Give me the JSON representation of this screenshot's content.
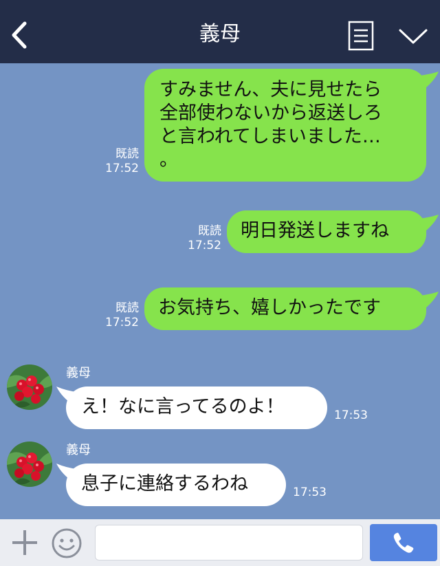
{
  "header": {
    "title": "義母",
    "back_icon": "chevron-left-icon",
    "notes_icon": "notes-icon",
    "menu_icon": "chevron-down-icon"
  },
  "messages": [
    {
      "direction": "outgoing",
      "lines": [
        "すみません、夫に見せたら",
        "全部使わないから返送しろ",
        "と言われてしまいました…",
        "。"
      ],
      "read": "既読",
      "time": "17:52"
    },
    {
      "direction": "outgoing",
      "lines": [
        "明日発送しますね"
      ],
      "read": "既読",
      "time": "17:52"
    },
    {
      "direction": "outgoing",
      "lines": [
        "お気持ち、嬉しかったです"
      ],
      "read": "既読",
      "time": "17:52"
    },
    {
      "direction": "incoming",
      "sender": "義母",
      "lines": [
        "え！なに言ってるのよ！"
      ],
      "time": "17:53"
    },
    {
      "direction": "incoming",
      "sender": "義母",
      "lines": [
        "息子に連絡するわね"
      ],
      "time": "17:53"
    }
  ],
  "input": {
    "value": "",
    "placeholder": ""
  },
  "icons": {
    "plus": "plus-icon",
    "emoji": "smiley-icon",
    "call": "phone-icon"
  },
  "colors": {
    "header_bg": "#232d48",
    "chat_bg": "#7494c4",
    "outgoing_bubble": "#86e34c",
    "incoming_bubble": "#ffffff",
    "call_button": "#5584e0"
  }
}
